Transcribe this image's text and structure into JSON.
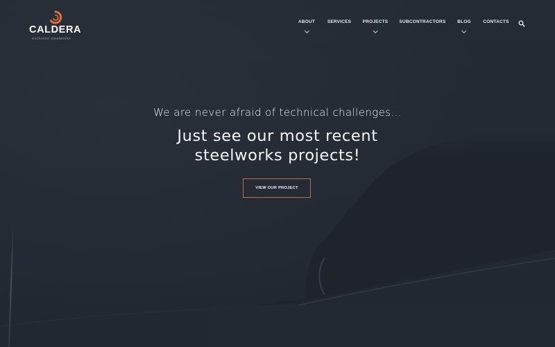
{
  "brand": {
    "name": "CALDERA",
    "tagline": "exclusive steelworks",
    "accent_color": "#e0703a",
    "logo_icon": "spiral-icon"
  },
  "nav": {
    "items": [
      {
        "label": "ABOUT",
        "has_dropdown": true
      },
      {
        "label": "SERVICES",
        "has_dropdown": false
      },
      {
        "label": "PROJECTS",
        "has_dropdown": true
      },
      {
        "label": "SUBCONTRACTORS",
        "has_dropdown": false
      },
      {
        "label": "BLOG",
        "has_dropdown": true
      },
      {
        "label": "CONTACTS",
        "has_dropdown": false
      }
    ],
    "search_icon": "search-icon"
  },
  "hero": {
    "subtitle": "We are never afraid of technical challenges…",
    "title_line1": "Just see our most recent",
    "title_line2": "steelworks projects!",
    "cta_label": "VIEW OUR PROJECT",
    "cta_border_color": "#b5714c"
  },
  "colors": {
    "background": "#242a33",
    "text": "#ffffff"
  }
}
